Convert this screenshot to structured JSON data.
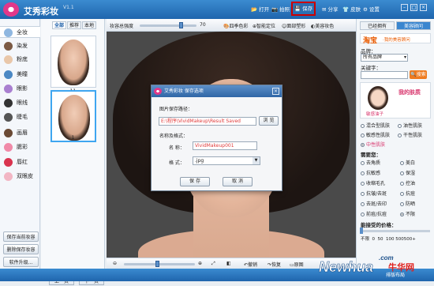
{
  "app": {
    "title": "艾秀彩妆",
    "version": "V1.1"
  },
  "toolbar": {
    "open": "打开",
    "take_photo": "拍照",
    "save": "保存",
    "share": "分享",
    "skin": "皮肤",
    "settings": "设置"
  },
  "sidebar": {
    "items": [
      {
        "label": "全妆",
        "icon": "full-makeup-icon",
        "color": "#8fb7e0"
      },
      {
        "label": "染发",
        "icon": "hair-dye-icon",
        "color": "#7b5a44"
      },
      {
        "label": "粉底",
        "icon": "foundation-icon",
        "color": "#e9c7a9"
      },
      {
        "label": "美瞳",
        "icon": "contact-lens-icon",
        "color": "#4b88c4"
      },
      {
        "label": "眼影",
        "icon": "eyeshadow-icon",
        "color": "#a97fd0"
      },
      {
        "label": "眼线",
        "icon": "eyeliner-icon",
        "color": "#333333"
      },
      {
        "label": "睫毛",
        "icon": "eyelash-icon",
        "color": "#555555"
      },
      {
        "label": "画眉",
        "icon": "eyebrow-icon",
        "color": "#6a4a35"
      },
      {
        "label": "腮彩",
        "icon": "blush-icon",
        "color": "#f08aa8"
      },
      {
        "label": "唇红",
        "icon": "lipstick-icon",
        "color": "#d9344f"
      },
      {
        "label": "双眼皮",
        "icon": "double-eyelid-icon",
        "color": "#f2b6c4"
      }
    ],
    "save_current": "保存当前妆容",
    "delete_saved": "删除保存妆容",
    "upgrade": "软件升级..."
  },
  "thumbs": {
    "tabs": [
      "全部",
      "推荐",
      "本地"
    ],
    "items": [
      {
        "num": "11"
      },
      {
        "num": "1"
      }
    ],
    "prev": "上一页",
    "next": "下一页"
  },
  "canvas_toolbar": {
    "strength_label": "妆容总强度",
    "strength_value": "70",
    "four_season": "四季色彩",
    "smart_locate": "智能定位",
    "face_shape": "面部塑形",
    "makeup_color": "美容妆色"
  },
  "bottom_toolbar": {
    "undo": "撤销",
    "restore": "恢复",
    "original": "原图"
  },
  "dialog": {
    "title": "艾秀彩妆 保存选项",
    "path_label": "图片保存路径：",
    "path_value": "E:\\程序\\VividMakeup\\Result Saved",
    "browse": "浏 览",
    "name_format_label": "名称及格式：",
    "name_label": "名 称：",
    "name_value": "VividMakeup001",
    "format_label": "格 式：",
    "format_value": ".jpg",
    "save": "保 存",
    "cancel": "取 消"
  },
  "right_panel": {
    "tabs": [
      "已经拥有",
      "美容顾问"
    ],
    "taobao": "淘宝",
    "taobao_sub": "·我的美容顾问",
    "brand_label": "品牌：",
    "brand_value": "所有品牌",
    "keyword_label": "关键字：",
    "search": "搜索",
    "skin_title": "我的肤质",
    "my_skin": "敏感油子",
    "skin_types": [
      {
        "label": "混合型肌肤",
        "checked": false
      },
      {
        "label": "油性肌肤",
        "checked": false
      },
      {
        "label": "敏感性肌肤",
        "checked": false
      },
      {
        "label": "干性肌肤",
        "checked": false
      },
      {
        "label": "中性肌肤",
        "checked": true
      }
    ],
    "needs_label": "需要您：",
    "needs": [
      {
        "label": "去角质",
        "checked": false
      },
      {
        "label": "美白",
        "checked": false
      },
      {
        "label": "抗敏感",
        "checked": false
      },
      {
        "label": "保湿",
        "checked": false
      },
      {
        "label": "收缩毛孔",
        "checked": false
      },
      {
        "label": "控油",
        "checked": false
      },
      {
        "label": "抗皱/去斑",
        "checked": false
      },
      {
        "label": "抗痘",
        "checked": false
      },
      {
        "label": "去斑/去印",
        "checked": false
      },
      {
        "label": "防晒",
        "checked": false
      },
      {
        "label": "前痘/抗痘",
        "checked": false
      },
      {
        "label": "不限",
        "checked": true
      }
    ],
    "price_label": "能接受的价格：",
    "prices": [
      "不限",
      "0",
      "50",
      "100",
      "500",
      "500+"
    ]
  },
  "status": {
    "layout": "排版布局"
  },
  "watermark": {
    "brand": "Newhua",
    "domain": ".com",
    "cn": "牛华网"
  },
  "colors": {
    "accent": "#1f65ad",
    "highlight": "#cc0000",
    "path_text": "#e03b3b"
  }
}
